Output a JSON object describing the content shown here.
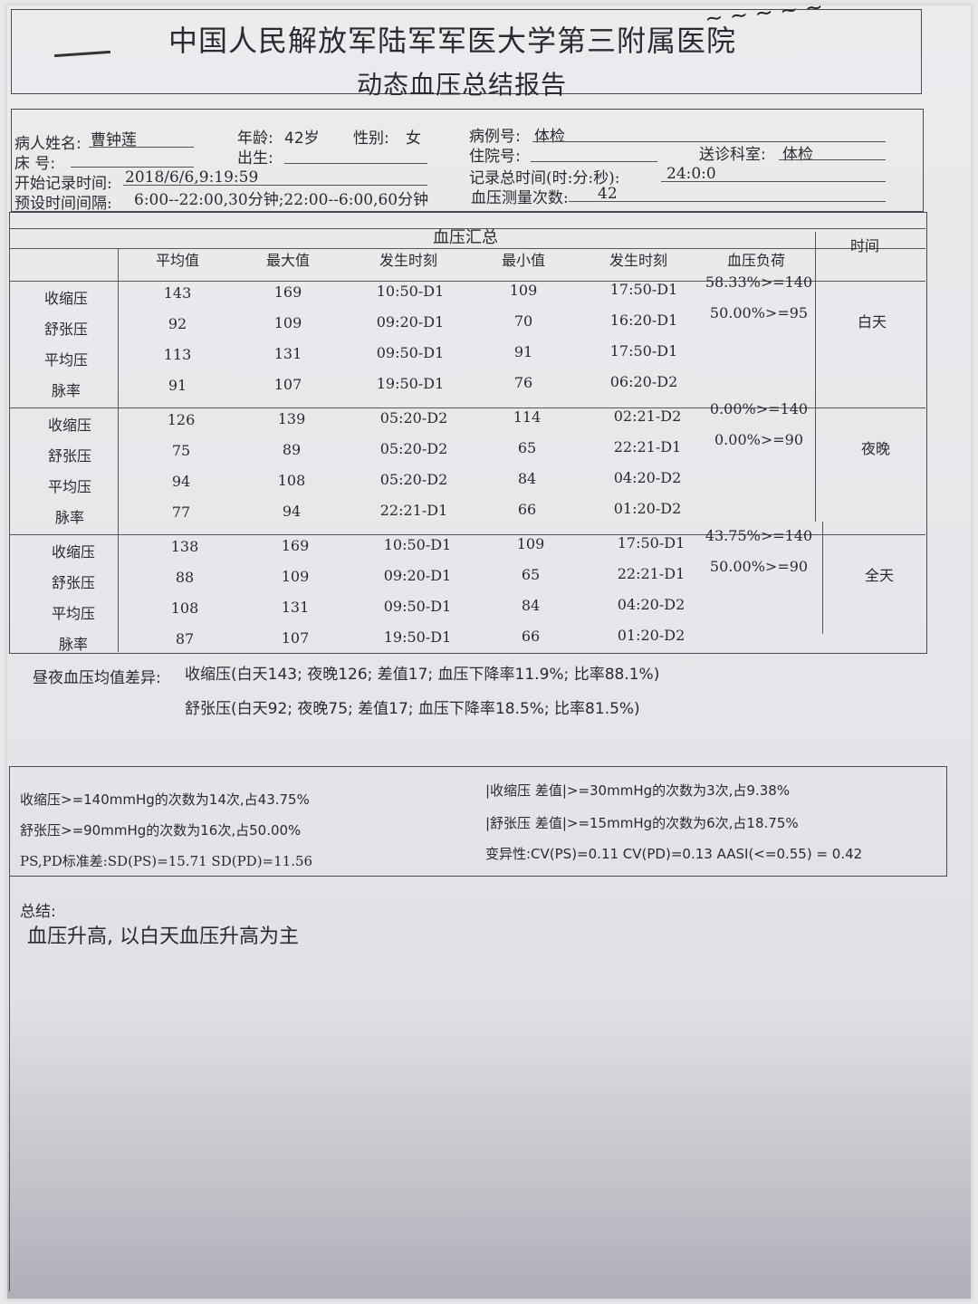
{
  "header": {
    "hospital": "中国人民解放军陆军军医大学第三附属医院",
    "report_title": "动态血压总结报告"
  },
  "patient": {
    "name_label": "病人姓名:",
    "name": "曹钟莲",
    "age_label": "年龄:",
    "age": "42岁",
    "sex_label": "性别:",
    "sex": "女",
    "case_label": "病例号:",
    "case_no": "体检",
    "bed_label": "床  号:",
    "birth_label": "出生:",
    "admit_label": "住院号:",
    "dept_label": "送诊科室:",
    "dept": "体检",
    "start_label": "开始记录时间:",
    "start_time": "2018/6/6,9:19:59",
    "total_label": "记录总时间(时:分:秒):",
    "total_time": "24:0:0",
    "interval_label": "预设时间间隔:",
    "interval": "6:00--22:00,30分钟;22:00--6:00,60分钟",
    "count_label": "血压测量次数:",
    "count": "42"
  },
  "summary": {
    "title": "血压汇总",
    "headers": [
      "平均值",
      "最大值",
      "发生时刻",
      "最小值",
      "发生时刻",
      "血压负荷",
      "时间"
    ],
    "row_labels": [
      "收缩压",
      "舒张压",
      "平均压",
      "脉率"
    ],
    "groups": [
      {
        "period": "白天",
        "rows": [
          [
            "143",
            "169",
            "10:50-D1",
            "109",
            "17:50-D1"
          ],
          [
            "92",
            "109",
            "09:20-D1",
            "70",
            "16:20-D1"
          ],
          [
            "113",
            "131",
            "09:50-D1",
            "91",
            "17:50-D1"
          ],
          [
            "91",
            "107",
            "19:50-D1",
            "76",
            "06:20-D2"
          ]
        ],
        "load": [
          "58.33%>=140",
          "50.00%>=95"
        ]
      },
      {
        "period": "夜晚",
        "rows": [
          [
            "126",
            "139",
            "05:20-D2",
            "114",
            "02:21-D2"
          ],
          [
            "75",
            "89",
            "05:20-D2",
            "65",
            "22:21-D1"
          ],
          [
            "94",
            "108",
            "05:20-D2",
            "84",
            "04:20-D2"
          ],
          [
            "77",
            "94",
            "22:21-D1",
            "66",
            "01:20-D2"
          ]
        ],
        "load": [
          "0.00%>=140",
          "0.00%>=90"
        ]
      },
      {
        "period": "全天",
        "rows": [
          [
            "138",
            "169",
            "10:50-D1",
            "109",
            "17:50-D1"
          ],
          [
            "88",
            "109",
            "09:20-D1",
            "65",
            "22:21-D1"
          ],
          [
            "108",
            "131",
            "09:50-D1",
            "84",
            "04:20-D2"
          ],
          [
            "87",
            "107",
            "19:50-D1",
            "66",
            "01:20-D2"
          ]
        ],
        "load": [
          "43.75%>=140",
          "50.00%>=90"
        ]
      }
    ]
  },
  "diff": {
    "label": "昼夜血压均值差异:",
    "systolic": "收缩压(白天143; 夜晚126; 差值17; 血压下降率11.9%; 比率88.1%)",
    "diastolic": "舒张压(白天92; 夜晚75; 差值17; 血压下降率18.5%; 比率81.5%)"
  },
  "stats": {
    "left1": "收缩压>=140mmHg的次数为14次,占43.75%",
    "left2": "舒张压>=90mmHg的次数为16次,占50.00%",
    "left3": "PS,PD标准差:SD(PS)=15.71   SD(PD)=11.56",
    "right1": "|收缩压  差值|>=30mmHg的次数为3次,占9.38%",
    "right2": "|舒张压  差值|>=15mmHg的次数为6次,占18.75%",
    "right3": "变异性:CV(PS)=0.11   CV(PD)=0.13     AASI(<=0.55) = 0.42"
  },
  "conclusion": {
    "label": "总结:",
    "text": "血压升高, 以白天血压升高为主"
  }
}
